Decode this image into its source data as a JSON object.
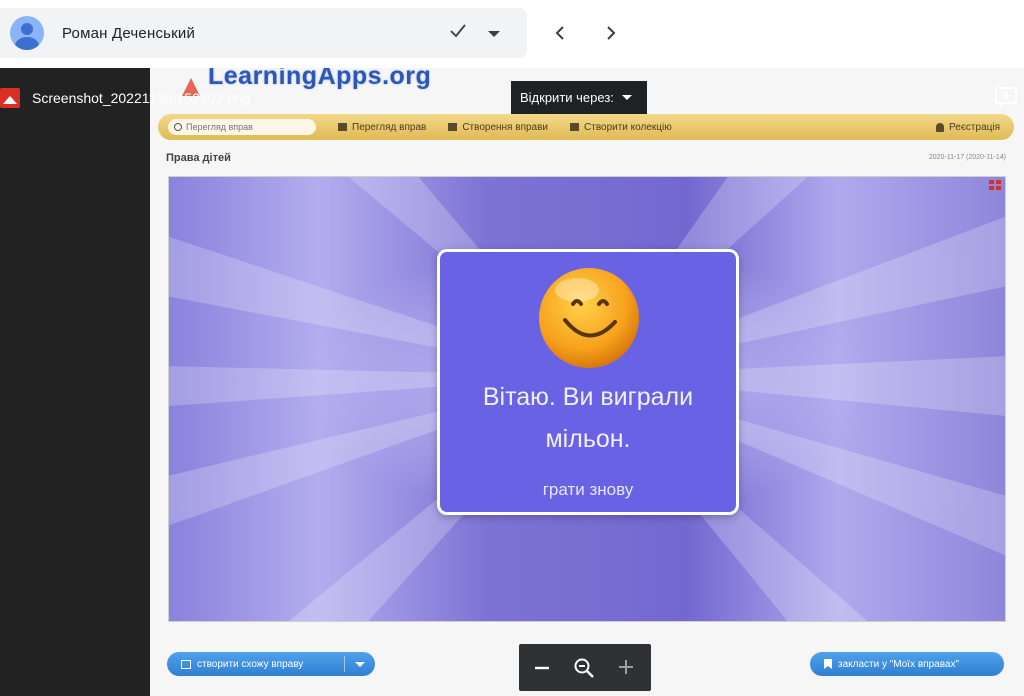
{
  "account": {
    "name": "Роман Деченський",
    "avatar_color": "#8ab4f8"
  },
  "file": {
    "name": "Screenshot_20221130-152302.png",
    "icon": "image-file-icon"
  },
  "viewer": {
    "open_with_label": "Відкрити через:",
    "add_icon": "add-to-drive-icon",
    "zoom": {
      "out_icon": "zoom-out-icon",
      "reset_icon": "zoom-reset-icon",
      "in_icon": "zoom-in-icon"
    }
  },
  "screenshot": {
    "logo": "LearningApps.org",
    "toolbar": {
      "search_placeholder": "Перегляд вправ",
      "browse": "Перегляд вправ",
      "create": "Створення вправи",
      "collection": "Створити колекцію",
      "register": "Реєстрація"
    },
    "page_title": "Права дітей",
    "date": "2020-11-17 (2020-11-14)",
    "card": {
      "message": "Вітаю. Ви виграли мільон.",
      "replay": "грати знову",
      "color": "#6a62e4"
    },
    "buttons": {
      "create_own": "створити схожу вправу",
      "bookmark": "закласти у \"Моїх вправах\""
    }
  }
}
